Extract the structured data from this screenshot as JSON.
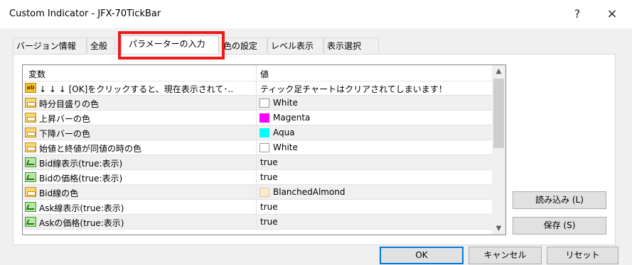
{
  "window": {
    "title": "Custom Indicator - JFX-70TickBar",
    "help_label": "?",
    "close_label": "×"
  },
  "tabs": [
    {
      "label": "バージョン情報",
      "active": false
    },
    {
      "label": "全般",
      "active": false
    },
    {
      "label": "パラメーターの入力",
      "active": true
    },
    {
      "label": "色の設定",
      "active": false
    },
    {
      "label": "レベル表示",
      "active": false
    },
    {
      "label": "表示選択",
      "active": false
    }
  ],
  "grid": {
    "header": {
      "variable": "変数",
      "value": "値"
    },
    "rows": [
      {
        "icon": "text-param-icon",
        "name": "↓ ↓ ↓ [OK]をクリックすると、現在表示されて･..",
        "value": "ティック足チャートはクリアされてしまいます！",
        "swatch": ""
      },
      {
        "icon": "color-param-icon",
        "name": "時分目盛りの色",
        "value": "White",
        "swatch": "#ffffff"
      },
      {
        "icon": "color-param-icon",
        "name": "上昇バーの色",
        "value": "Magenta",
        "swatch": "#ff00ff"
      },
      {
        "icon": "color-param-icon",
        "name": "下降バーの色",
        "value": "Aqua",
        "swatch": "#00ffff"
      },
      {
        "icon": "color-param-icon",
        "name": "始値と終値が同値の時の色",
        "value": "White",
        "swatch": "#ffffff"
      },
      {
        "icon": "bool-param-icon",
        "name": "Bid線表示(true:表示)",
        "value": "true",
        "swatch": ""
      },
      {
        "icon": "bool-param-icon",
        "name": "Bidの価格(true:表示)",
        "value": "true",
        "swatch": ""
      },
      {
        "icon": "color-param-icon",
        "name": "Bid線の色",
        "value": "BlanchedAlmond",
        "swatch": "#ffebcd"
      },
      {
        "icon": "bool-param-icon",
        "name": "Ask線表示(true:表示)",
        "value": "true",
        "swatch": ""
      },
      {
        "icon": "bool-param-icon",
        "name": "Askの価格(true:表示)",
        "value": "true",
        "swatch": ""
      }
    ]
  },
  "buttons": {
    "load": "読み込み (L)",
    "save": "保存 (S)",
    "ok": "OK",
    "cancel": "キャンセル",
    "reset": "リセット"
  },
  "colors": {
    "highlight_box": "#ee1a1a",
    "ok_border": "#0078d7"
  }
}
